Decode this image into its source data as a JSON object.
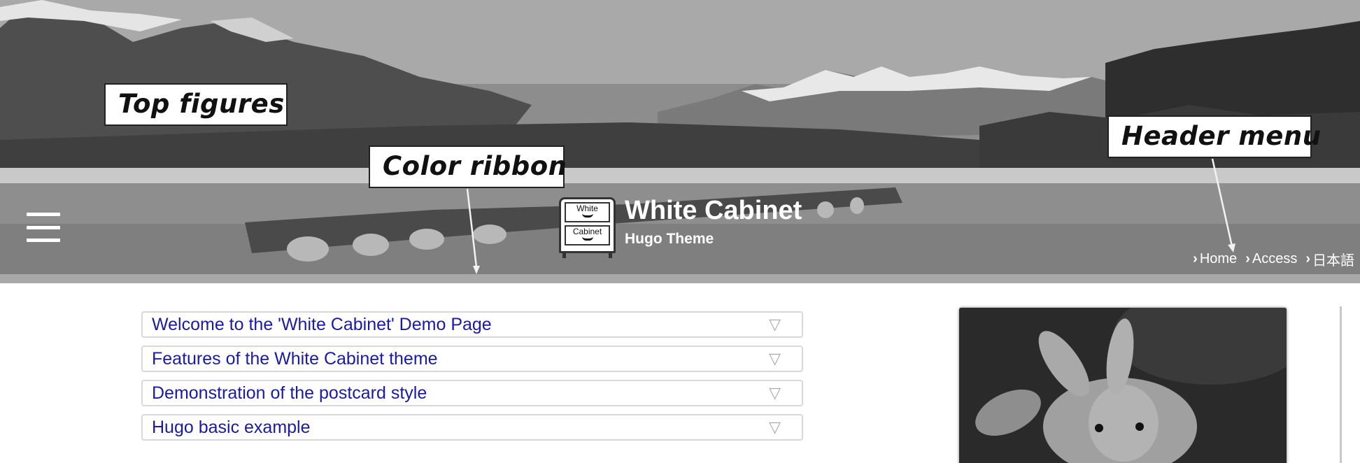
{
  "header": {
    "site_title": "White Cabinet",
    "site_subtitle": "Hugo Theme",
    "logo": {
      "drawer_top": "White",
      "drawer_bottom": "Cabinet"
    },
    "menu_icon": "hamburger-menu-icon",
    "nav": [
      {
        "label": "Home",
        "icon": "chevron-right-icon"
      },
      {
        "label": "Access",
        "icon": "chevron-right-icon"
      },
      {
        "label": "日本語",
        "icon": "chevron-right-icon"
      }
    ],
    "ribbon_color": "#a8a8a8"
  },
  "annotations": {
    "top_figures": "Top figures",
    "color_ribbon": "Color ribbon",
    "header_menu": "Header menu"
  },
  "main": {
    "articles": [
      {
        "title": "Welcome to the 'White Cabinet' Demo Page",
        "toggle": "▽"
      },
      {
        "title": "Features of the White Cabinet theme",
        "toggle": "▽"
      },
      {
        "title": "Demonstration of the postcard style",
        "toggle": "▽"
      },
      {
        "title": "Hugo basic example",
        "toggle": "▽"
      }
    ],
    "link_color": "#1a1aa6"
  },
  "sidebar": {
    "photo": "rabbit-photo"
  }
}
